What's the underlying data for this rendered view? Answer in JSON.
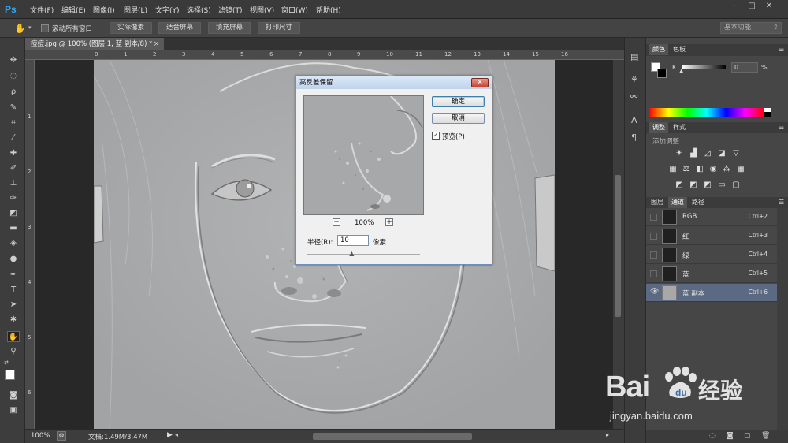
{
  "app": {
    "logo": "Ps",
    "menu": [
      "文件(F)",
      "编辑(E)",
      "图像(I)",
      "图层(L)",
      "文字(Y)",
      "选择(S)",
      "滤镜(T)",
      "视图(V)",
      "窗口(W)",
      "帮助(H)"
    ],
    "window_controls": [
      "–",
      "□",
      "✕"
    ]
  },
  "options_bar": {
    "scroll_all_label": "滚动所有窗口",
    "buttons": [
      "实际像素",
      "适合屏幕",
      "填充屏幕",
      "打印尺寸"
    ],
    "workspace": "基本功能"
  },
  "document": {
    "tab_title": "痘痘.jpg @ 100% (图层 1, 蓝 副本/8) *",
    "zoom": "100%",
    "doc_info": "文档:1.49M/3.47M",
    "ruler_h": [
      "0",
      "1",
      "2",
      "3",
      "4",
      "5",
      "6",
      "7",
      "8",
      "9",
      "10",
      "11",
      "12",
      "13",
      "14",
      "15",
      "16"
    ],
    "ruler_v": [
      "1",
      "2",
      "3",
      "4",
      "5",
      "6"
    ]
  },
  "dialog": {
    "title": "高反差保留",
    "ok": "确定",
    "cancel": "取消",
    "preview_label": "预览(P)",
    "preview_checked": true,
    "zoom": "100%",
    "radius_label": "半径(R):",
    "radius_value": "10",
    "radius_unit": "像素",
    "radius_slider_fraction": 0.4
  },
  "color_panel": {
    "tabs": [
      "颜色",
      "色板"
    ],
    "k_label": "K",
    "k_value": "0",
    "k_unit": "%"
  },
  "adjust_panel": {
    "tabs": [
      "调整",
      "样式"
    ],
    "add_label": "添加调整"
  },
  "channels_panel": {
    "tabs": [
      "图层",
      "通道",
      "路径"
    ],
    "active_tab": "通道",
    "rows": [
      {
        "name": "RGB",
        "key": "Ctrl+2"
      },
      {
        "name": "红",
        "key": "Ctrl+3"
      },
      {
        "name": "绿",
        "key": "Ctrl+4"
      },
      {
        "name": "蓝",
        "key": "Ctrl+5"
      },
      {
        "name": "蓝 副本",
        "key": "Ctrl+6"
      }
    ]
  },
  "watermark": {
    "brand_text": "Bai",
    "brand_text2": "经验",
    "url": "jingyan.baidu.com"
  }
}
